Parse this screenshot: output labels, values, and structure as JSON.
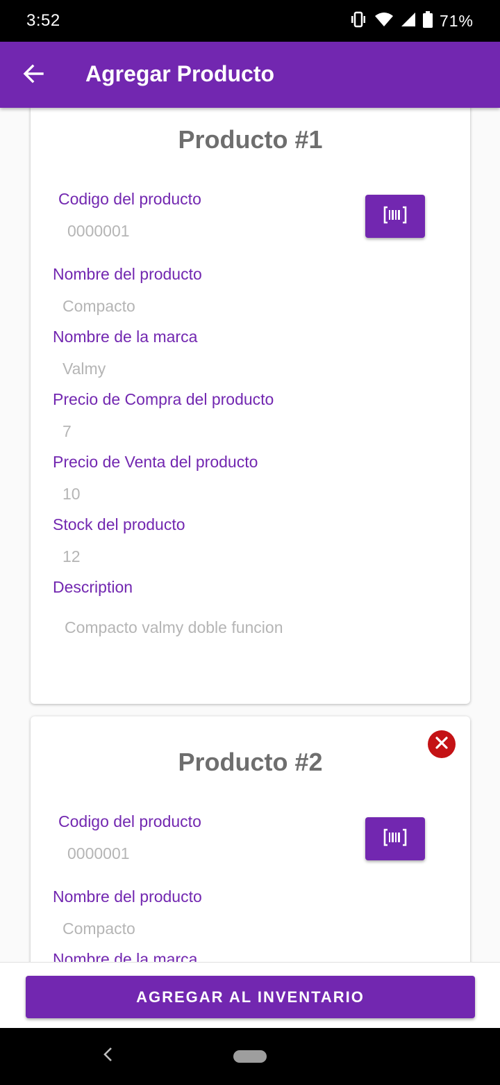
{
  "status_bar": {
    "time": "3:52",
    "battery": "71%"
  },
  "app_bar": {
    "title": "Agregar Producto"
  },
  "colors": {
    "primary": "#7227b0",
    "danger": "#c41215",
    "label": "#7227b0",
    "value": "#b5b5b5"
  },
  "icons": {
    "back": "arrow-left-icon",
    "scan": "barcode-scan-icon",
    "remove": "close-circle-icon",
    "vibrate": "vibrate-icon",
    "wifi": "wifi-icon",
    "signal": "signal-icon",
    "battery": "battery-icon"
  },
  "products": [
    {
      "title": "Producto #1",
      "fields": [
        {
          "label": "Codigo del producto",
          "value": "0000001"
        },
        {
          "label": "Nombre del producto",
          "value": "Compacto"
        },
        {
          "label": "Nombre de la marca",
          "value": "Valmy"
        },
        {
          "label": "Precio de Compra del producto",
          "value": "7"
        },
        {
          "label": "Precio de Venta del producto",
          "value": "10"
        },
        {
          "label": "Stock del producto",
          "value": "12"
        },
        {
          "label": "Description",
          "value": "Compacto valmy doble funcion"
        }
      ]
    },
    {
      "title": "Producto #2",
      "fields": [
        {
          "label": "Codigo del producto",
          "value": "0000001"
        },
        {
          "label": "Nombre del producto",
          "value": "Compacto"
        },
        {
          "label": "Nombre de la marca",
          "value": ""
        }
      ]
    }
  ],
  "actions": {
    "add_to_inventory": "AGREGAR AL INVENTARIO"
  }
}
